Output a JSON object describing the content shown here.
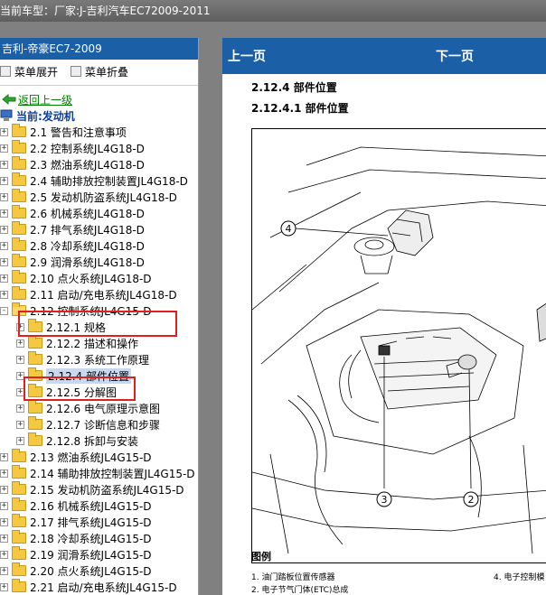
{
  "window": {
    "title": "当前车型：厂家:J-吉利汽车EC72009-2011"
  },
  "sidebar": {
    "header": "吉利-帝豪EC7-2009",
    "expand_all": "菜单展开",
    "collapse_all": "菜单折叠",
    "back_link": "返回上一级",
    "current_label": "当前:发动机",
    "items": [
      {
        "label": "2.1 警告和注意事项",
        "level": 0
      },
      {
        "label": "2.2 控制系统JL4G18-D",
        "level": 0
      },
      {
        "label": "2.3 燃油系统JL4G18-D",
        "level": 0
      },
      {
        "label": "2.4 辅助排放控制装置JL4G18-D",
        "level": 0
      },
      {
        "label": "2.5 发动机防盗系统JL4G18-D",
        "level": 0
      },
      {
        "label": "2.6 机械系统JL4G18-D",
        "level": 0
      },
      {
        "label": "2.7 排气系统JL4G18-D",
        "level": 0
      },
      {
        "label": "2.8 冷却系统JL4G18-D",
        "level": 0
      },
      {
        "label": "2.9 润滑系统JL4G18-D",
        "level": 0
      },
      {
        "label": "2.10 点火系统JL4G18-D",
        "level": 0
      },
      {
        "label": "2.11 启动/充电系统JL4G18-D",
        "level": 0
      },
      {
        "label": "2.12 控制系统JL4G15-D",
        "level": 0,
        "expanded": true
      },
      {
        "label": "2.12.1 规格",
        "level": 1
      },
      {
        "label": "2.12.2 描述和操作",
        "level": 1
      },
      {
        "label": "2.12.3 系统工作原理",
        "level": 1
      },
      {
        "label": "2.12.4 部件位置",
        "level": 1,
        "selected": true
      },
      {
        "label": "2.12.5 分解图",
        "level": 1
      },
      {
        "label": "2.12.6 电气原理示意图",
        "level": 1
      },
      {
        "label": "2.12.7 诊断信息和步骤",
        "level": 1
      },
      {
        "label": "2.12.8 拆卸与安装",
        "level": 1
      },
      {
        "label": "2.13 燃油系统JL4G15-D",
        "level": 0
      },
      {
        "label": "2.14 辅助排放控制装置JL4G15-D",
        "level": 0
      },
      {
        "label": "2.15 发动机防盗系统JL4G15-D",
        "level": 0
      },
      {
        "label": "2.16 机械系统JL4G15-D",
        "level": 0
      },
      {
        "label": "2.17 排气系统JL4G15-D",
        "level": 0
      },
      {
        "label": "2.18 冷却系统JL4G15-D",
        "level": 0
      },
      {
        "label": "2.19 润滑系统JL4G15-D",
        "level": 0
      },
      {
        "label": "2.20 点火系统JL4G15-D",
        "level": 0
      },
      {
        "label": "2.21 启动/充电系统JL4G15-D",
        "level": 0
      }
    ]
  },
  "content": {
    "prev_page": "上一页",
    "next_page": "下一页",
    "section_title": "2.12.4 部件位置",
    "subsection_title": "2.12.4.1 部件位置",
    "callouts": [
      "4",
      "3",
      "2"
    ],
    "legend_title": "图例",
    "legend": [
      "1.    油门踏板位置传感器",
      "2.    电子节气门体(ETC)总成",
      "4.    电子控制模"
    ]
  },
  "colors": {
    "panel_header": "#1b5fa6",
    "highlight_box": "#e0201c",
    "folder": "#f5c842"
  }
}
